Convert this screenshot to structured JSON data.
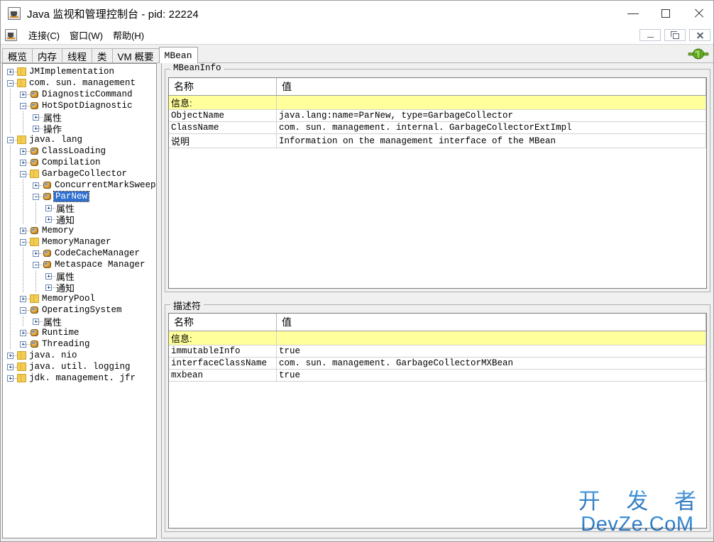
{
  "window": {
    "title": "Java 监视和管理控制台 - pid: 22224",
    "app_icon": "java-cup-icon",
    "controls": {
      "minimize": "minimize-icon",
      "maximize": "maximize-icon",
      "close": "close-icon"
    }
  },
  "menubar": {
    "icon": "java-cup-icon",
    "items": [
      {
        "label": "连接(C)"
      },
      {
        "label": "窗口(W)"
      },
      {
        "label": "帮助(H)"
      }
    ],
    "frame_controls": {
      "minimize": "internal-minimize-icon",
      "restore": "internal-restore-icon",
      "close": "internal-close-icon"
    }
  },
  "tabs": {
    "items": [
      {
        "label": "概览",
        "selected": false
      },
      {
        "label": "内存",
        "selected": false
      },
      {
        "label": "线程",
        "selected": false
      },
      {
        "label": "类",
        "selected": false
      },
      {
        "label": "VM 概要",
        "selected": false
      },
      {
        "label": "MBean",
        "selected": true
      }
    ],
    "status_icon": "green-connector-plug-icon"
  },
  "tree": {
    "nodes": [
      {
        "label": "JMImplementation",
        "indent": 0,
        "toggle": "plus",
        "icon": "folder-icon",
        "cjk": false,
        "selected": false
      },
      {
        "label": "com. sun. management",
        "indent": 0,
        "toggle": "minus",
        "icon": "folder-icon",
        "cjk": false,
        "selected": false
      },
      {
        "label": "DiagnosticCommand",
        "indent": 1,
        "toggle": "plus",
        "icon": "mbean-icon",
        "cjk": false,
        "selected": false
      },
      {
        "label": "HotSpotDiagnostic",
        "indent": 1,
        "toggle": "minus",
        "icon": "mbean-icon",
        "cjk": false,
        "selected": false
      },
      {
        "label": "属性",
        "indent": 2,
        "toggle": "plus",
        "icon": "none",
        "cjk": true,
        "selected": false
      },
      {
        "label": "操作",
        "indent": 2,
        "toggle": "plus",
        "icon": "none",
        "cjk": true,
        "selected": false
      },
      {
        "label": "java. lang",
        "indent": 0,
        "toggle": "minus",
        "icon": "folder-icon",
        "cjk": false,
        "selected": false
      },
      {
        "label": "ClassLoading",
        "indent": 1,
        "toggle": "plus",
        "icon": "mbean-icon",
        "cjk": false,
        "selected": false
      },
      {
        "label": "Compilation",
        "indent": 1,
        "toggle": "plus",
        "icon": "mbean-icon",
        "cjk": false,
        "selected": false
      },
      {
        "label": "GarbageCollector",
        "indent": 1,
        "toggle": "minus",
        "icon": "folder-icon",
        "cjk": false,
        "selected": false
      },
      {
        "label": "ConcurrentMarkSweep",
        "indent": 2,
        "toggle": "plus",
        "icon": "mbean-icon",
        "cjk": false,
        "selected": false
      },
      {
        "label": "ParNew",
        "indent": 2,
        "toggle": "minus",
        "icon": "mbean-icon",
        "cjk": false,
        "selected": true
      },
      {
        "label": "属性",
        "indent": 3,
        "toggle": "plus",
        "icon": "none",
        "cjk": true,
        "selected": false
      },
      {
        "label": "通知",
        "indent": 3,
        "toggle": "plus",
        "icon": "none",
        "cjk": true,
        "selected": false
      },
      {
        "label": "Memory",
        "indent": 1,
        "toggle": "plus",
        "icon": "mbean-icon",
        "cjk": false,
        "selected": false
      },
      {
        "label": "MemoryManager",
        "indent": 1,
        "toggle": "minus",
        "icon": "folder-icon",
        "cjk": false,
        "selected": false
      },
      {
        "label": "CodeCacheManager",
        "indent": 2,
        "toggle": "plus",
        "icon": "mbean-icon",
        "cjk": false,
        "selected": false
      },
      {
        "label": "Metaspace Manager",
        "indent": 2,
        "toggle": "minus",
        "icon": "mbean-icon",
        "cjk": false,
        "selected": false
      },
      {
        "label": "属性",
        "indent": 3,
        "toggle": "plus",
        "icon": "none",
        "cjk": true,
        "selected": false
      },
      {
        "label": "通知",
        "indent": 3,
        "toggle": "plus",
        "icon": "none",
        "cjk": true,
        "selected": false
      },
      {
        "label": "MemoryPool",
        "indent": 1,
        "toggle": "plus",
        "icon": "folder-icon",
        "cjk": false,
        "selected": false
      },
      {
        "label": "OperatingSystem",
        "indent": 1,
        "toggle": "minus",
        "icon": "mbean-icon",
        "cjk": false,
        "selected": false
      },
      {
        "label": "属性",
        "indent": 2,
        "toggle": "plus",
        "icon": "none",
        "cjk": true,
        "selected": false
      },
      {
        "label": "Runtime",
        "indent": 1,
        "toggle": "plus",
        "icon": "mbean-icon",
        "cjk": false,
        "selected": false
      },
      {
        "label": "Threading",
        "indent": 1,
        "toggle": "plus",
        "icon": "mbean-icon",
        "cjk": false,
        "selected": false
      },
      {
        "label": "java. nio",
        "indent": 0,
        "toggle": "plus",
        "icon": "folder-icon",
        "cjk": false,
        "selected": false
      },
      {
        "label": "java. util. logging",
        "indent": 0,
        "toggle": "plus",
        "icon": "folder-icon",
        "cjk": false,
        "selected": false
      },
      {
        "label": "jdk. management. jfr",
        "indent": 0,
        "toggle": "plus",
        "icon": "folder-icon",
        "cjk": false,
        "selected": false
      }
    ]
  },
  "mbeaninfo": {
    "title": "MBeanInfo",
    "columns": [
      "名称",
      "值"
    ],
    "rows": [
      {
        "name": "信息:",
        "value": "",
        "info": true,
        "name_cjk": true,
        "value_cjk": false
      },
      {
        "name": "ObjectName",
        "value": "java.lang:name=ParNew, type=GarbageCollector",
        "info": false,
        "name_cjk": false,
        "value_cjk": false
      },
      {
        "name": "ClassName",
        "value": "com. sun. management. internal. GarbageCollectorExtImpl",
        "info": false,
        "name_cjk": false,
        "value_cjk": false
      },
      {
        "name": "说明",
        "value": "Information on the management interface of the MBean",
        "info": false,
        "name_cjk": true,
        "value_cjk": false
      }
    ]
  },
  "descriptor": {
    "title": "描述符",
    "columns": [
      "名称",
      "值"
    ],
    "rows": [
      {
        "name": "信息:",
        "value": "",
        "info": true,
        "name_cjk": true,
        "value_cjk": false
      },
      {
        "name": "immutableInfo",
        "value": "true",
        "info": false,
        "name_cjk": false,
        "value_cjk": false
      },
      {
        "name": "interfaceClassName",
        "value": "com. sun. management. GarbageCollectorMXBean",
        "info": false,
        "name_cjk": false,
        "value_cjk": false
      },
      {
        "name": "mxbean",
        "value": "true",
        "info": false,
        "name_cjk": false,
        "value_cjk": false
      }
    ]
  },
  "watermark": {
    "line1": "开 发 者",
    "line2": "DevZe.CoM"
  },
  "colors": {
    "info_row": "#ffff9c",
    "selection": "#2f6fd0",
    "panel_bg": "#f0f0f0",
    "watermark": "#2f7fd0",
    "status_ok": "#4f9f1f"
  }
}
